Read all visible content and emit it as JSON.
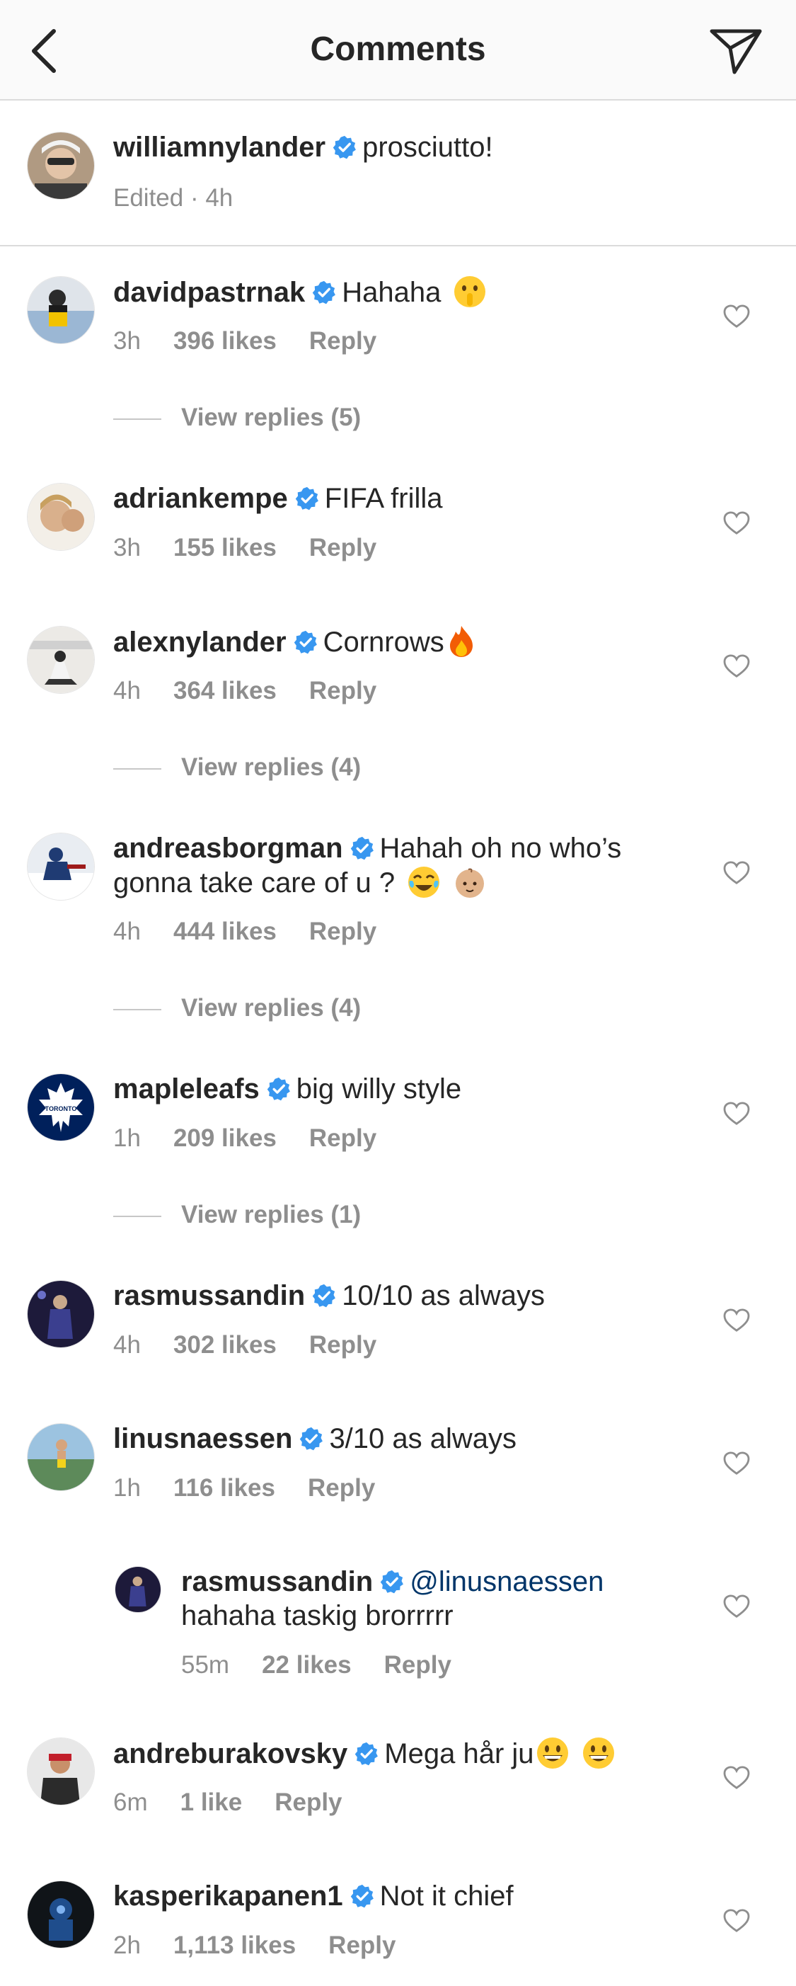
{
  "header": {
    "title": "Comments"
  },
  "caption": {
    "username": "williamnylander",
    "text": "prosciutto!",
    "meta": "Edited · 4h"
  },
  "comments": [
    {
      "username": "davidpastrnak",
      "text": "Hahaha",
      "time": "3h",
      "likes": "396 likes",
      "reply": "Reply",
      "view_replies": "View replies (5)"
    },
    {
      "username": "adriankempe",
      "text": "FIFA frilla",
      "time": "3h",
      "likes": "155 likes",
      "reply": "Reply"
    },
    {
      "username": "alexnylander",
      "text": "Cornrows",
      "time": "4h",
      "likes": "364 likes",
      "reply": "Reply",
      "view_replies": "View replies (4)"
    },
    {
      "username": "andreasborgman",
      "text": "Hahah oh no who’s gonna take care of u ?",
      "time": "4h",
      "likes": "444 likes",
      "reply": "Reply",
      "view_replies": "View replies (4)"
    },
    {
      "username": "mapleleafs",
      "text": "big willy style",
      "time": "1h",
      "likes": "209 likes",
      "reply": "Reply",
      "view_replies": "View replies (1)"
    },
    {
      "username": "rasmussandin",
      "text": "10/10 as always",
      "time": "4h",
      "likes": "302 likes",
      "reply": "Reply"
    },
    {
      "username": "linusnaessen",
      "text": "3/10 as always",
      "time": "1h",
      "likes": "116 likes",
      "reply": "Reply"
    },
    {
      "username": "rasmussandin",
      "mention": "@linusnaessen",
      "text": "hahaha taskig brorrrrr",
      "time": "55m",
      "likes": "22 likes",
      "reply": "Reply"
    },
    {
      "username": "andreburakovsky",
      "text": "Mega hår ju",
      "time": "6m",
      "likes": "1 like",
      "reply": "Reply"
    },
    {
      "username": "kasperikapanen1",
      "text": "Not it chief",
      "time": "2h",
      "likes": "1,113 likes",
      "reply": "Reply"
    }
  ],
  "icons": {
    "back": "chevron-left-icon",
    "send": "paper-plane-icon",
    "like": "heart-outline-icon",
    "verified": "verified-badge-icon"
  },
  "colors": {
    "verified": "#3897f0",
    "secondary_text": "#8e8e8e",
    "mention": "#003569",
    "divider": "#dbdbdb"
  }
}
